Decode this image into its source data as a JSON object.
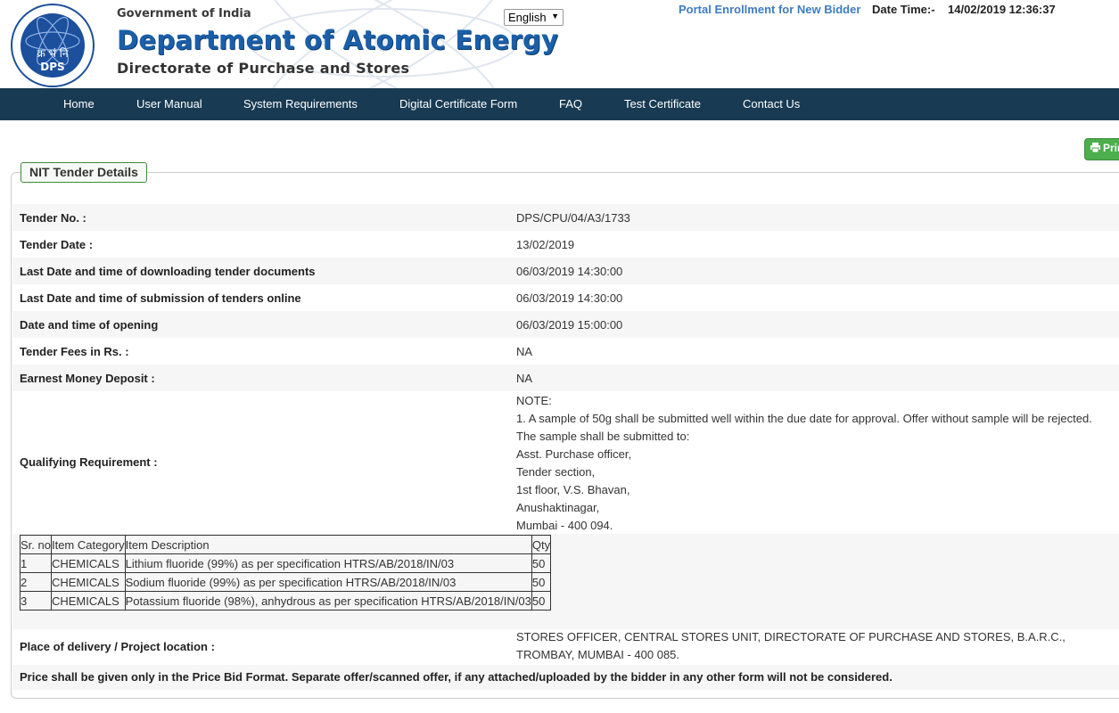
{
  "header": {
    "gov": "Government of India",
    "dept": "Department of Atomic Energy",
    "directorate": "Directorate of Purchase and Stores",
    "logo_text": "DPS",
    "logo_hindi": "क्र भं नि",
    "language": "English",
    "enroll_link": "Portal Enrollment for New Bidder",
    "datetime_label": "Date Time:-",
    "datetime_value": "14/02/2019 12:36:37"
  },
  "nav": [
    "Home",
    "User Manual",
    "System Requirements",
    "Digital Certificate Form",
    "FAQ",
    "Test Certificate",
    "Contact Us"
  ],
  "print_label": "Prin",
  "legend": "NIT Tender Details",
  "details": [
    {
      "label": "Tender No. :",
      "value": "DPS/CPU/04/A3/1733"
    },
    {
      "label": "Tender Date :",
      "value": "13/02/2019"
    },
    {
      "label": "Last Date and time of downloading tender documents",
      "value": "06/03/2019 14:30:00"
    },
    {
      "label": "Last Date and time of submission of tenders online",
      "value": "06/03/2019 14:30:00"
    },
    {
      "label": "Date and time of opening",
      "value": "06/03/2019 15:00:00"
    },
    {
      "label": "Tender Fees in Rs. :",
      "value": "NA"
    },
    {
      "label": "Earnest Money Deposit :",
      "value": "NA"
    }
  ],
  "qualifying": {
    "label": "Qualifying Requirement :",
    "lines": [
      "NOTE:",
      "1. A sample of 50g shall be submitted well within the due date for approval. Offer without sample will be rejected. The sample shall be submitted to:",
      "Asst. Purchase officer,",
      "Tender section,",
      "1st floor, V.S. Bhavan,",
      "Anushaktinagar,",
      "Mumbai - 400 094."
    ]
  },
  "items": {
    "headers": [
      "Sr. no",
      "Item Category",
      "Item Description",
      "Qty"
    ],
    "rows": [
      [
        "1",
        "CHEMICALS",
        "Lithium fluoride (99%) as per specification HTRS/AB/2018/IN/03",
        "50"
      ],
      [
        "2",
        "CHEMICALS",
        "Sodium fluoride (99%) as per specification HTRS/AB/2018/IN/03",
        "50"
      ],
      [
        "3",
        "CHEMICALS",
        "Potassium fluoride (98%), anhydrous as per specification HTRS/AB/2018/IN/03",
        "50"
      ]
    ]
  },
  "delivery": {
    "label": "Place of delivery / Project location :",
    "value": "STORES OFFICER, CENTRAL STORES UNIT, DIRECTORATE OF PURCHASE AND STORES, B.A.R.C., TROMBAY, MUMBAI - 400 085."
  },
  "price_note": "Price shall be given only in the Price Bid Format. Separate offer/scanned offer, if any attached/uploaded by the bidder in any other form will not be considered."
}
